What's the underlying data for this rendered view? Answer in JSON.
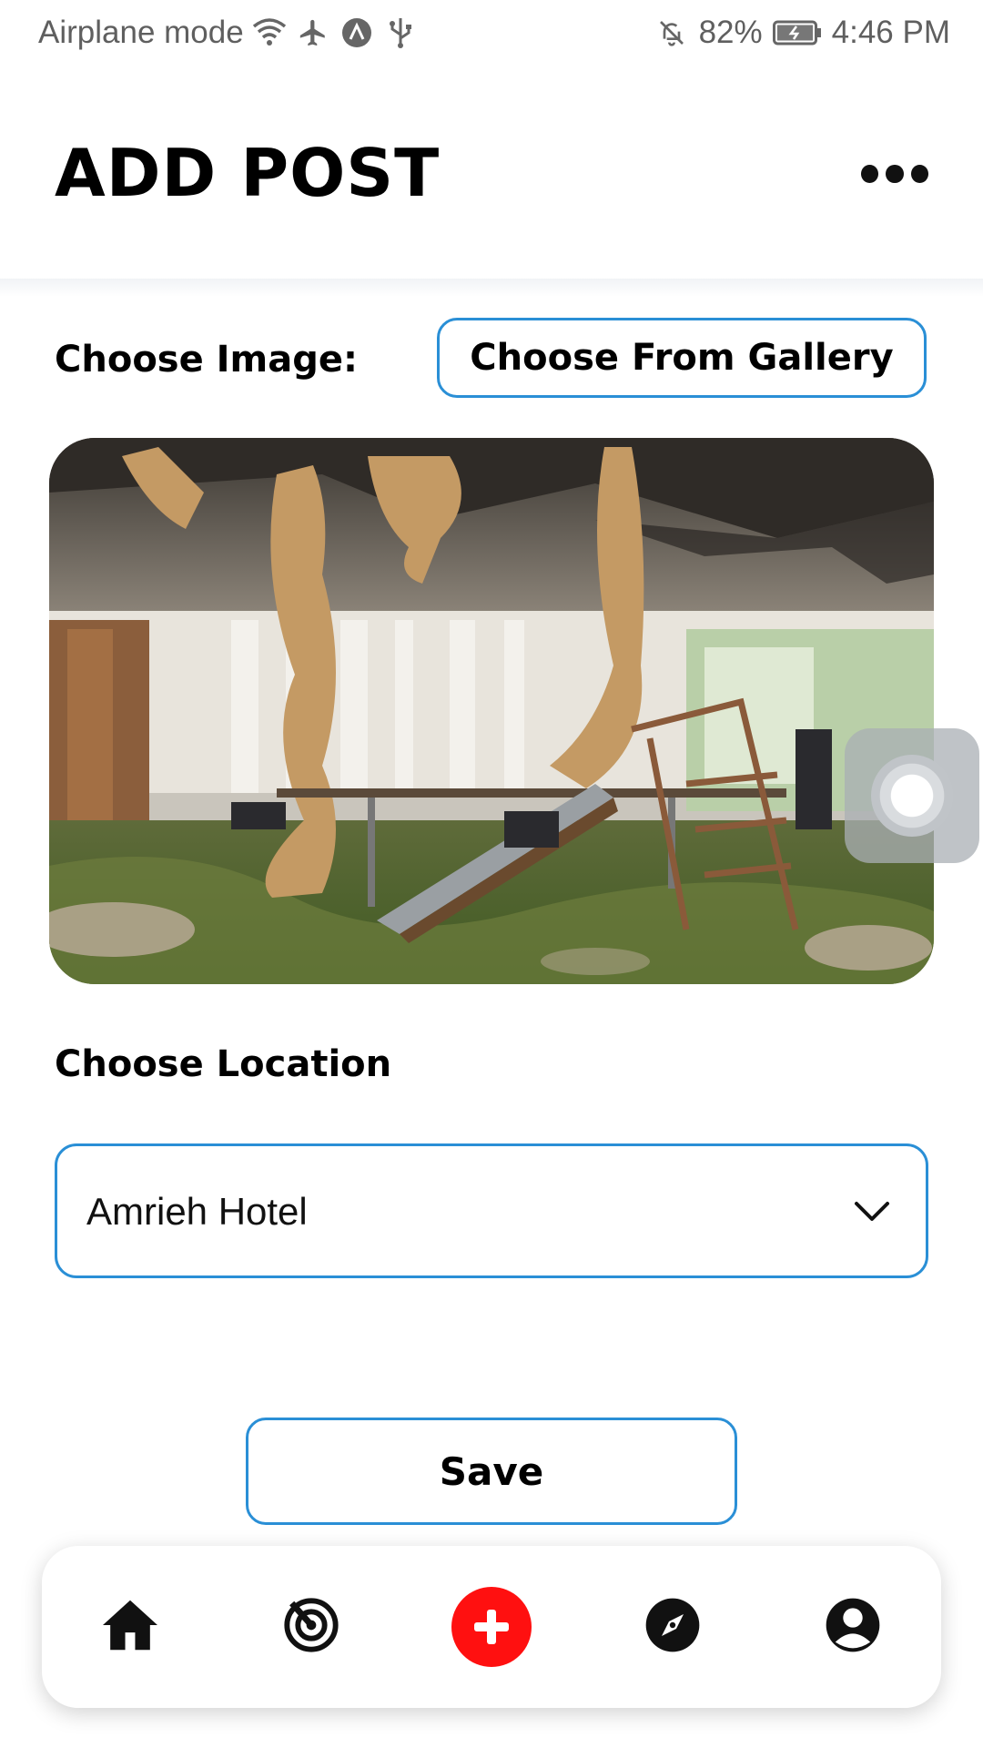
{
  "status_bar": {
    "left_text": "Airplane mode",
    "battery": "82%",
    "time": "4:46 PM",
    "icons": [
      "wifi-icon",
      "airplane-icon",
      "app-notification-icon",
      "usb-icon",
      "bell-off-icon",
      "battery-icon"
    ]
  },
  "header": {
    "title": "ADD POST",
    "menu_icon": "more-dots-icon"
  },
  "image_section": {
    "label": "Choose Image:",
    "button_label": "Choose From Gallery"
  },
  "location_section": {
    "label": "Choose Location",
    "selected_value": "Amrieh Hotel"
  },
  "actions": {
    "save_label": "Save"
  },
  "bottom_nav": {
    "items": [
      {
        "icon": "home-icon"
      },
      {
        "icon": "radar-icon"
      },
      {
        "icon": "add-icon",
        "accent": "#ff1010"
      },
      {
        "icon": "compass-icon"
      },
      {
        "icon": "profile-icon"
      }
    ]
  },
  "colors": {
    "accent_border": "#2a8fd6",
    "add_button": "#ff1010",
    "text": "#000000"
  }
}
